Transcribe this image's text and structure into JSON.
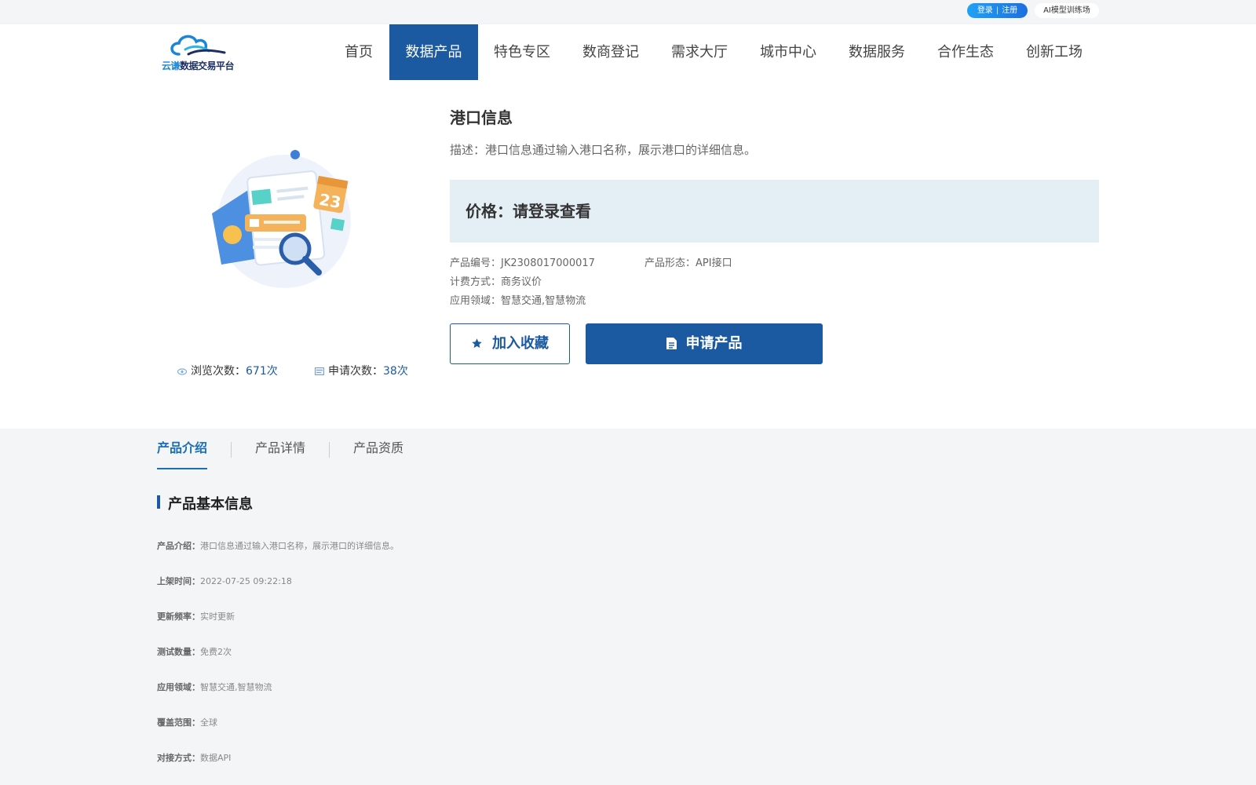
{
  "topbar": {
    "login": "登录",
    "separator": "|",
    "register": "注册",
    "ai_training": "AI模型训练场"
  },
  "logo": {
    "brand": "云谦",
    "suffix": "数据交易平台"
  },
  "nav": {
    "items": [
      {
        "label": "首页",
        "active": false
      },
      {
        "label": "数据产品",
        "active": true
      },
      {
        "label": "特色专区",
        "active": false
      },
      {
        "label": "数商登记",
        "active": false
      },
      {
        "label": "需求大厅",
        "active": false
      },
      {
        "label": "城市中心",
        "active": false
      },
      {
        "label": "数据服务",
        "active": false
      },
      {
        "label": "合作生态",
        "active": false
      },
      {
        "label": "创新工场",
        "active": false
      }
    ]
  },
  "product": {
    "title": "港口信息",
    "description": "描述：港口信息通过输入港口名称，展示港口的详细信息。",
    "price": "价格：请登录查看",
    "code_label": "产品编号：",
    "code": "JK2308017000017",
    "form_label": "产品形态：",
    "form": "API接口",
    "billing_label": "计费方式：",
    "billing": "商务议价",
    "domain_label": "应用领域：",
    "domain": "智慧交通,智慧物流",
    "favorite_button": "加入收藏",
    "apply_button": "申请产品",
    "views_label": "浏览次数：",
    "views": "671次",
    "applies_label": "申请次数：",
    "applies": "38次"
  },
  "tabs": {
    "items": [
      {
        "label": "产品介绍",
        "active": true
      },
      {
        "label": "产品详情",
        "active": false
      },
      {
        "label": "产品资质",
        "active": false
      }
    ]
  },
  "info": {
    "title": "产品基本信息",
    "rows": [
      {
        "key": "产品介绍：",
        "value": "港口信息通过输入港口名称，展示港口的详细信息。"
      },
      {
        "key": "上架时间：",
        "value": "2022-07-25 09:22:18"
      },
      {
        "key": "更新频率：",
        "value": "实时更新"
      },
      {
        "key": "测试数量：",
        "value": "免费2次"
      },
      {
        "key": "应用领域：",
        "value": "智慧交通,智慧物流"
      },
      {
        "key": "覆盖范围：",
        "value": "全球"
      },
      {
        "key": "对接方式：",
        "value": "数据API"
      }
    ]
  },
  "colors": {
    "primary": "#1b5aa0",
    "accent": "#1b6fb5",
    "price_bg": "#e4eef5",
    "page_bg": "#f4f5f7"
  },
  "icons": {
    "logo": "cloud-logo-icon",
    "views": "eye-icon",
    "applies": "form-icon",
    "favorite": "star-icon",
    "apply": "document-icon",
    "illustration": "document-calendar-illustration"
  }
}
